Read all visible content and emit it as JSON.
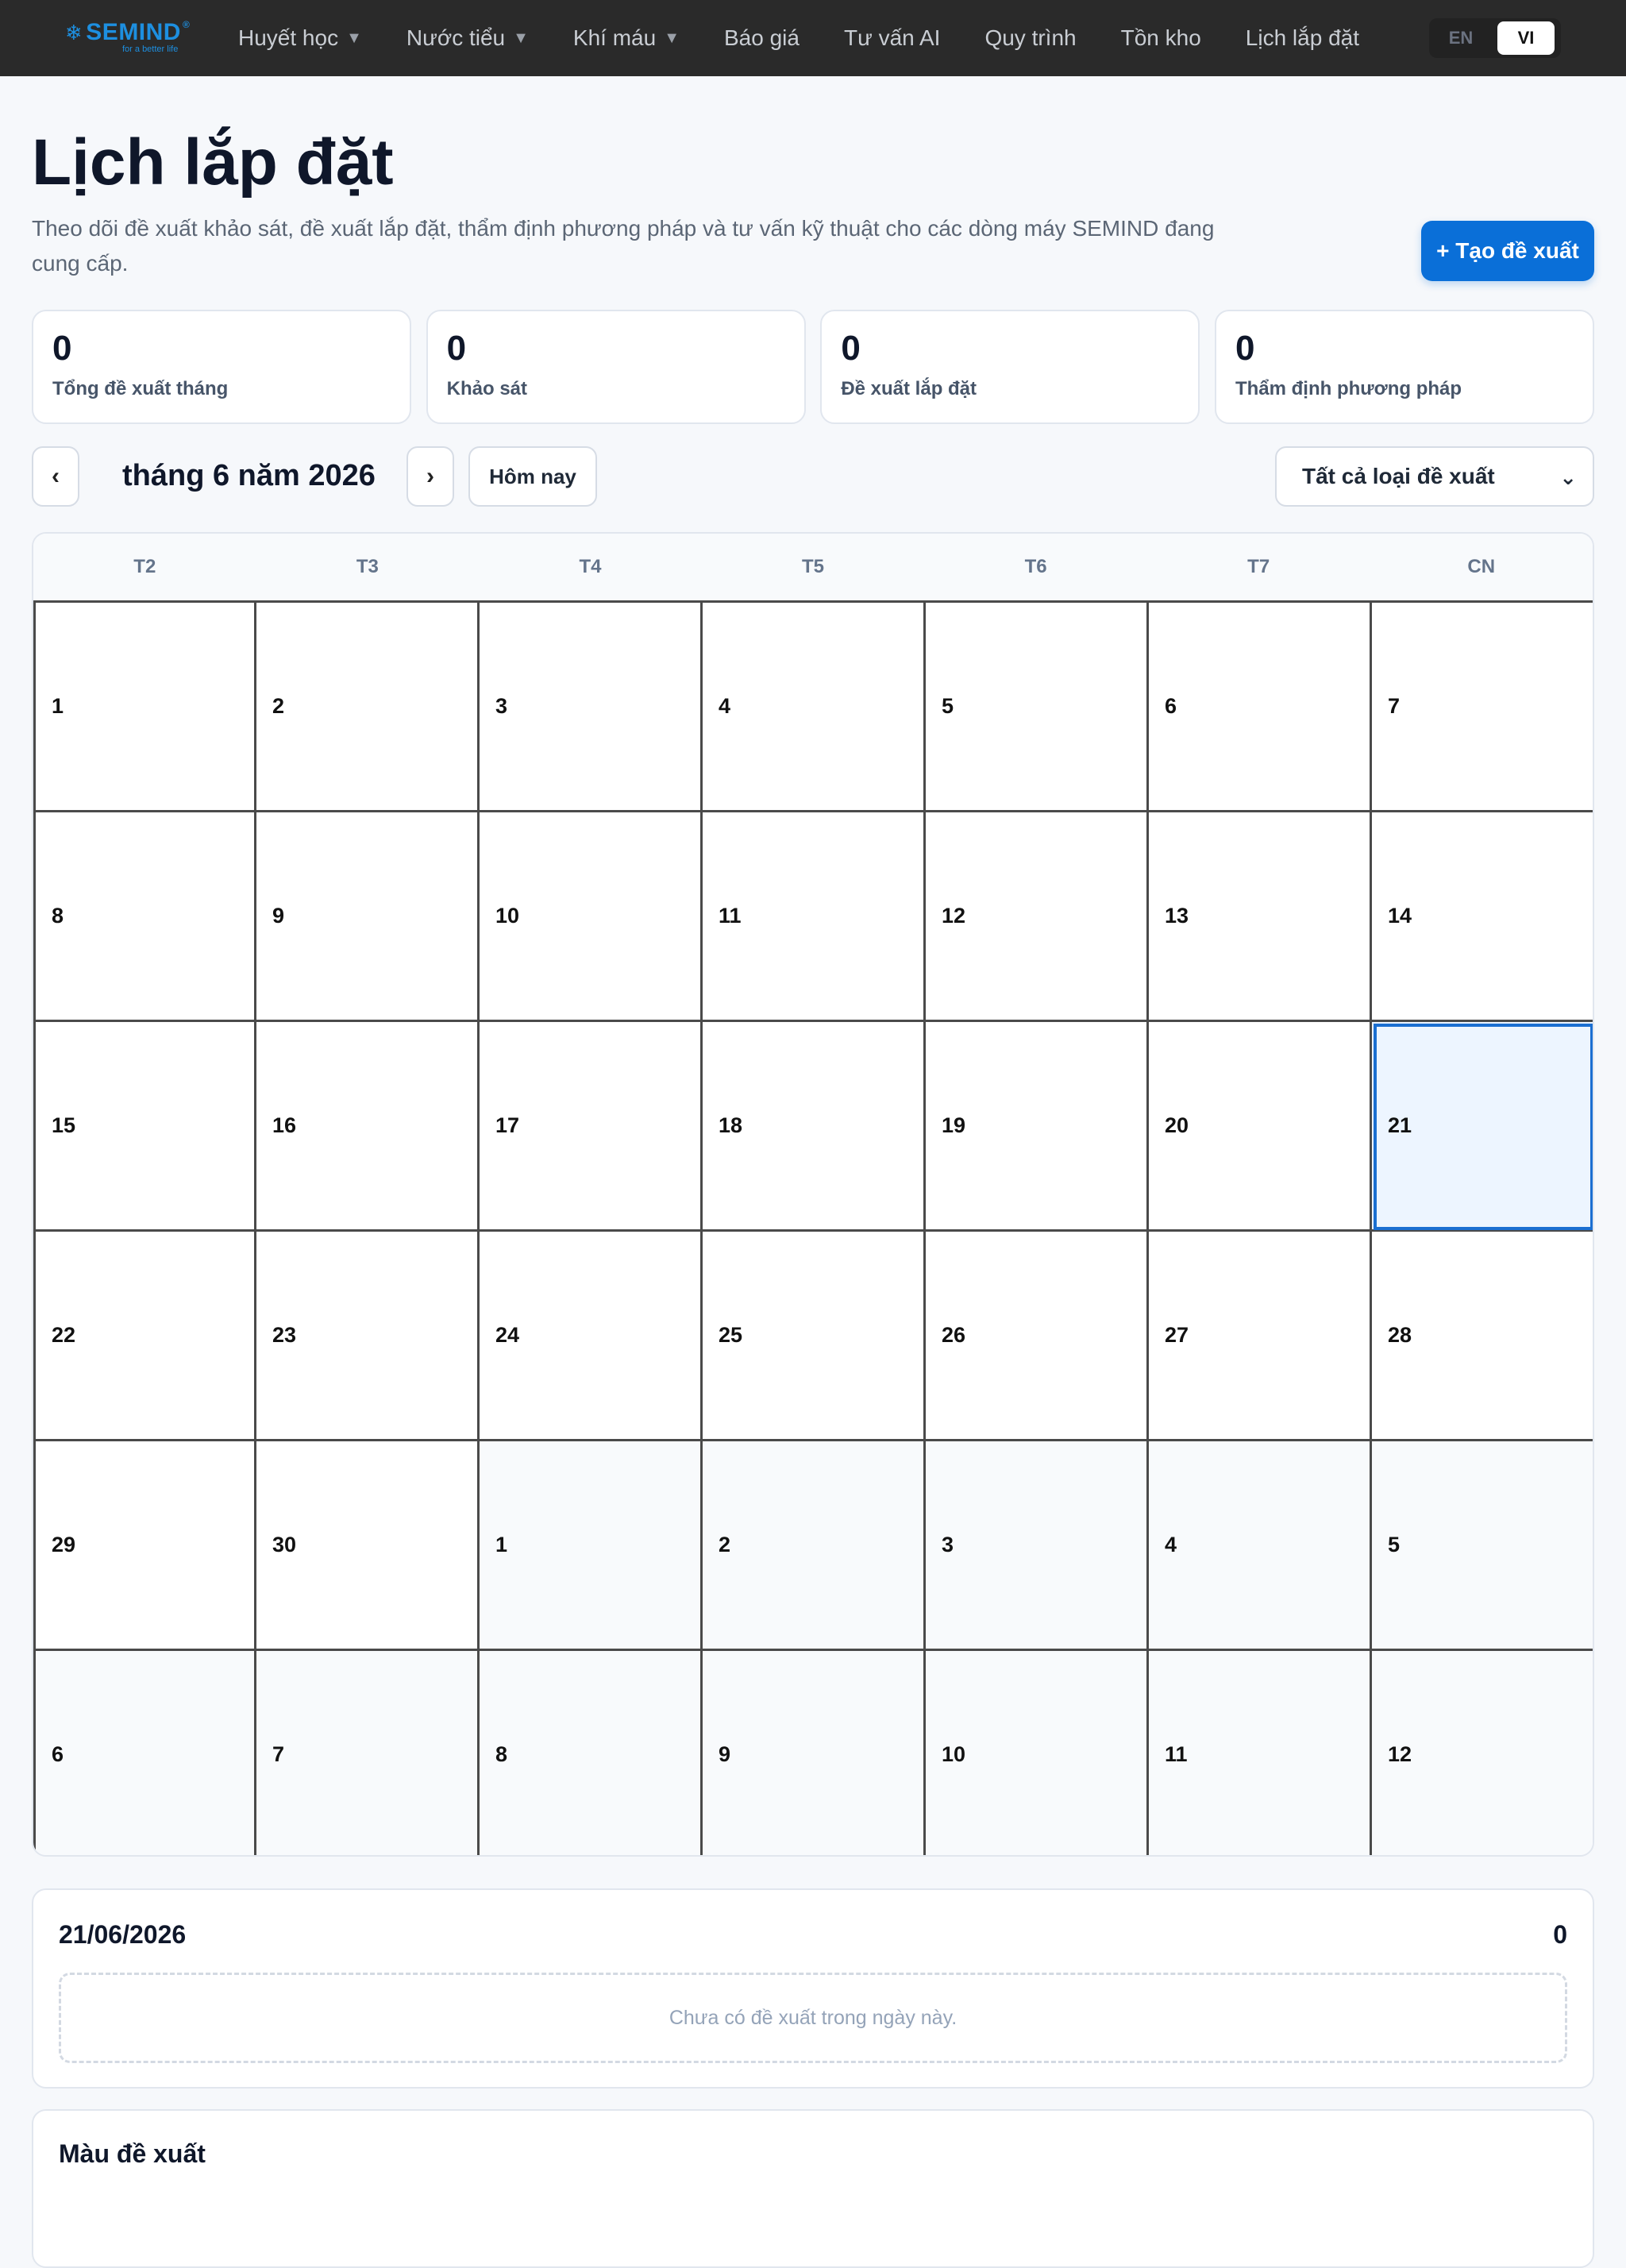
{
  "brand": {
    "name": "SEMIND",
    "reg": "®",
    "tagline": "for a better life"
  },
  "nav": {
    "items": [
      {
        "label": "Huyết học",
        "dropdown": true
      },
      {
        "label": "Nước tiểu",
        "dropdown": true
      },
      {
        "label": "Khí máu",
        "dropdown": true
      },
      {
        "label": "Báo giá",
        "dropdown": false
      },
      {
        "label": "Tư vấn AI",
        "dropdown": false
      },
      {
        "label": "Quy trình",
        "dropdown": false
      },
      {
        "label": "Tồn kho",
        "dropdown": false
      },
      {
        "label": "Lịch lắp đặt",
        "dropdown": false
      }
    ],
    "lang": {
      "en": "EN",
      "vi": "VI",
      "active": "VI"
    }
  },
  "header": {
    "title": "Lịch lắp đặt",
    "description": "Theo dõi đề xuất khảo sát, đề xuất lắp đặt, thẩm định phương pháp và tư vấn kỹ thuật cho các dòng máy SEMIND đang cung cấp.",
    "create_label": "+ Tạo đề xuất"
  },
  "stats": [
    {
      "value": "0",
      "label": "Tổng đề xuất tháng"
    },
    {
      "value": "0",
      "label": "Khảo sát"
    },
    {
      "value": "0",
      "label": "Đề xuất lắp đặt"
    },
    {
      "value": "0",
      "label": "Thẩm định phương pháp"
    }
  ],
  "toolbar": {
    "prev": "‹",
    "next": "›",
    "month_label": "tháng 6 năm 2026",
    "today_label": "Hôm nay",
    "filter_value": "Tất cả loại đề xuất",
    "chevron": "⌄"
  },
  "calendar": {
    "weekdays": [
      "T2",
      "T3",
      "T4",
      "T5",
      "T6",
      "T7",
      "CN"
    ],
    "selected": "21",
    "days": [
      {
        "d": "1",
        "out": false
      },
      {
        "d": "2",
        "out": false
      },
      {
        "d": "3",
        "out": false
      },
      {
        "d": "4",
        "out": false
      },
      {
        "d": "5",
        "out": false
      },
      {
        "d": "6",
        "out": false
      },
      {
        "d": "7",
        "out": false
      },
      {
        "d": "8",
        "out": false
      },
      {
        "d": "9",
        "out": false
      },
      {
        "d": "10",
        "out": false
      },
      {
        "d": "11",
        "out": false
      },
      {
        "d": "12",
        "out": false
      },
      {
        "d": "13",
        "out": false
      },
      {
        "d": "14",
        "out": false
      },
      {
        "d": "15",
        "out": false
      },
      {
        "d": "16",
        "out": false
      },
      {
        "d": "17",
        "out": false
      },
      {
        "d": "18",
        "out": false
      },
      {
        "d": "19",
        "out": false
      },
      {
        "d": "20",
        "out": false
      },
      {
        "d": "21",
        "out": false,
        "sel": true
      },
      {
        "d": "22",
        "out": false
      },
      {
        "d": "23",
        "out": false
      },
      {
        "d": "24",
        "out": false
      },
      {
        "d": "25",
        "out": false
      },
      {
        "d": "26",
        "out": false
      },
      {
        "d": "27",
        "out": false
      },
      {
        "d": "28",
        "out": false
      },
      {
        "d": "29",
        "out": false
      },
      {
        "d": "30",
        "out": false
      },
      {
        "d": "1",
        "out": true
      },
      {
        "d": "2",
        "out": true
      },
      {
        "d": "3",
        "out": true
      },
      {
        "d": "4",
        "out": true
      },
      {
        "d": "5",
        "out": true
      },
      {
        "d": "6",
        "out": true
      },
      {
        "d": "7",
        "out": true
      },
      {
        "d": "8",
        "out": true
      },
      {
        "d": "9",
        "out": true
      },
      {
        "d": "10",
        "out": true
      },
      {
        "d": "11",
        "out": true
      },
      {
        "d": "12",
        "out": true
      }
    ]
  },
  "day_panel": {
    "date": "21/06/2026",
    "count": "0",
    "empty_text": "Chưa có đề xuất trong ngày này."
  },
  "legend_panel": {
    "title": "Màu đề xuất"
  },
  "colors": {
    "nav_bg": "#2a2a2a",
    "brand": "#1d8fe0",
    "primary": "#0a6fd8",
    "selected_bg": "#edf5ff",
    "selected_border": "#1b6fd1"
  }
}
